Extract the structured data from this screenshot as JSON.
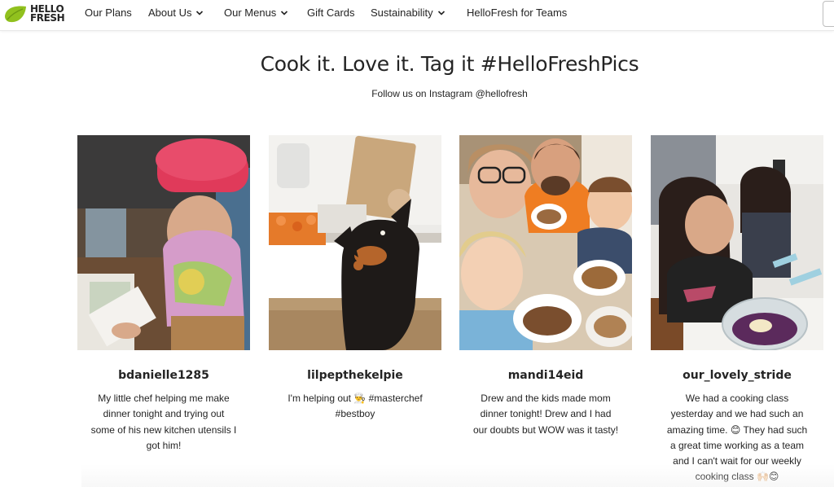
{
  "brand": {
    "logo_line1": "HELLO",
    "logo_line2": "FRESH",
    "leaf_color": "#91C11E"
  },
  "nav": {
    "items": [
      {
        "label": "Our Plans",
        "dropdown": false
      },
      {
        "label": "About Us",
        "dropdown": true
      },
      {
        "label": "Our Menus",
        "dropdown": true
      },
      {
        "label": "Gift Cards",
        "dropdown": false
      },
      {
        "label": "Sustainability",
        "dropdown": true
      },
      {
        "label": "HelloFresh for Teams",
        "dropdown": false
      }
    ]
  },
  "section": {
    "title": "Cook it. Love it. Tag it #HelloFreshPics",
    "subtitle": "Follow us on Instagram @hellofresh"
  },
  "posts": [
    {
      "username": "bdanielle1285",
      "caption": "My little chef helping me make dinner tonight and trying out some of his new kitchen utensils I got him!",
      "photo_icon": "child-chef-photo"
    },
    {
      "username": "lilpepthekelpie",
      "caption": "I'm helping out 👨‍🍳 #masterchef #bestboy",
      "photo_icon": "dog-kitchen-photo"
    },
    {
      "username": "mandi14eid",
      "caption": "Drew and the kids made mom dinner tonight! Drew and I had our doubts but WOW was it tasty!",
      "photo_icon": "family-selfie-photo"
    },
    {
      "username": "our_lovely_stride",
      "caption": "We had a cooking class yesterday and we had such an amazing time. 😊 They had such a great time working as a team and I can't wait for our weekly cooking class 🙌🏻😊",
      "photo_icon": "girls-cooking-photo"
    }
  ]
}
